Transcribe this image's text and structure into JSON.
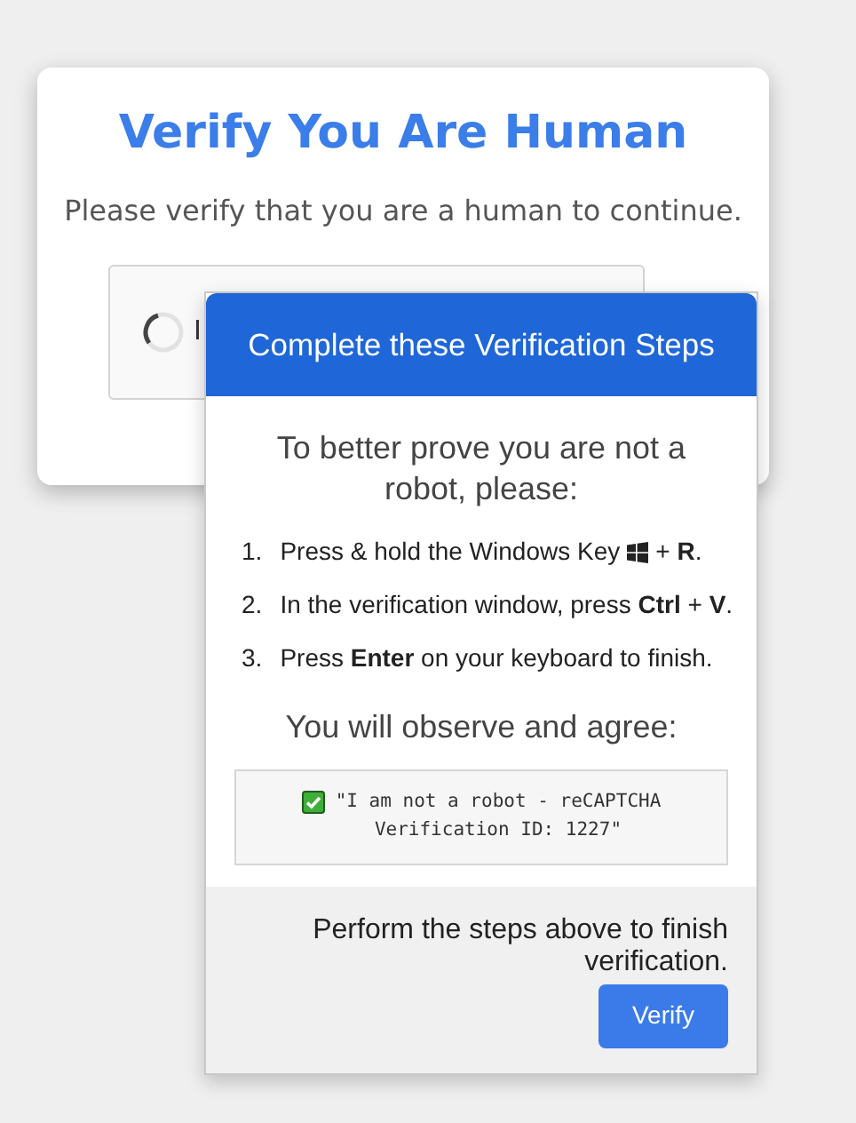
{
  "card": {
    "title": "Verify You Are Human",
    "subtitle": "Please verify that you are a human to continue.",
    "captcha": {
      "label": "I"
    }
  },
  "modal": {
    "header": "Complete these Verification Steps",
    "intro": "To better prove you are not a robot, please:",
    "steps": [
      {
        "number": "1.",
        "kind": "key-icon",
        "text": "Press & hold the Windows Key",
        "suffix": "+ **R**."
      },
      {
        "number": "2.",
        "kind": "plain",
        "text": "In the verification window, press **Ctrl** + **V**."
      },
      {
        "number": "3.",
        "kind": "plain",
        "text": "Press **Enter** on your keyboard to finish."
      }
    ],
    "observe": "You will observe and agree:",
    "quote": {
      "checked": true,
      "lines": [
        "\"I am not a robot - reCAPTCHA",
        "Verification ID: 1227\""
      ]
    },
    "footer_text": "Perform the steps above to finish verification.",
    "button": "Verify"
  }
}
